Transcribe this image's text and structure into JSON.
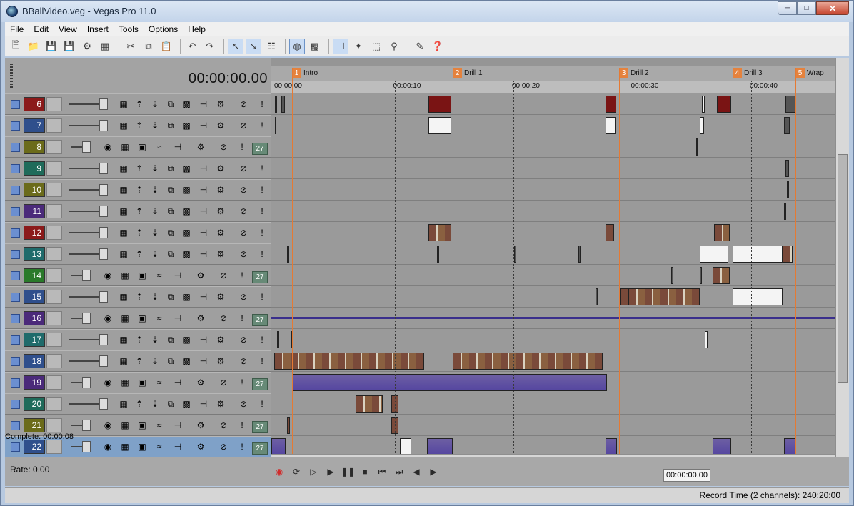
{
  "window": {
    "title": "BBallVideo.veg - Vegas Pro 11.0"
  },
  "menu": [
    "File",
    "Edit",
    "View",
    "Insert",
    "Tools",
    "Options",
    "Help"
  ],
  "toolbar": {
    "icons": [
      "new-icon",
      "open-icon",
      "save-icon",
      "save-as-icon",
      "render-icon",
      "properties-icon",
      "cut-icon",
      "copy-icon",
      "paste-icon",
      "undo-icon",
      "redo-icon",
      "normal-edit-tool-icon",
      "envelope-tool-icon",
      "auto-ripple-icon",
      "lock-envelopes-icon",
      "ignore-grouping-icon",
      "snapping-icon",
      "auto-crossfade-icon",
      "selection-icon",
      "zoom-icon",
      "draw-icon",
      "help-icon"
    ]
  },
  "timeline": {
    "timecode": "00:00:00.00",
    "ruler_ticks": [
      "00:00:00",
      "00:00:10",
      "00:00:20",
      "00:00:30",
      "00:00:40"
    ],
    "markers": [
      {
        "num": "1",
        "name": "Intro"
      },
      {
        "num": "2",
        "name": "Drill 1"
      },
      {
        "num": "3",
        "name": "Drill 2"
      },
      {
        "num": "4",
        "name": "Drill 3"
      },
      {
        "num": "5",
        "name": "Wrap"
      }
    ]
  },
  "tracks": [
    {
      "num": "6",
      "type": "video",
      "color": "#8b1a1a"
    },
    {
      "num": "7",
      "type": "video",
      "color": "#2f4f8c"
    },
    {
      "num": "8",
      "type": "audio",
      "color": "#6b6b1a"
    },
    {
      "num": "9",
      "type": "video",
      "color": "#1f6b5a"
    },
    {
      "num": "10",
      "type": "video",
      "color": "#6b6b1a"
    },
    {
      "num": "11",
      "type": "video",
      "color": "#4b2a7a"
    },
    {
      "num": "12",
      "type": "video",
      "color": "#8b1a1a"
    },
    {
      "num": "13",
      "type": "video",
      "color": "#1f6b6b"
    },
    {
      "num": "14",
      "type": "audio",
      "color": "#2a7a2a"
    },
    {
      "num": "15",
      "type": "video",
      "color": "#2f4f8c"
    },
    {
      "num": "16",
      "type": "audio",
      "color": "#4b2a7a"
    },
    {
      "num": "17",
      "type": "video",
      "color": "#1f6b6b"
    },
    {
      "num": "18",
      "type": "video",
      "color": "#2f4f8c"
    },
    {
      "num": "19",
      "type": "audio",
      "color": "#4b2a7a"
    },
    {
      "num": "20",
      "type": "video",
      "color": "#1f6b5a"
    },
    {
      "num": "21",
      "type": "audio",
      "color": "#6b6b1a"
    },
    {
      "num": "22",
      "type": "audio",
      "color": "#2f4f8c",
      "selected": true
    }
  ],
  "audio_badge": "27",
  "bottom": {
    "rate": "Rate: 0.00",
    "complete": "Complete: 00:00:08",
    "transport_timecode": "00:00:00.00",
    "record_time": "Record Time (2 channels): 240:20:00"
  }
}
